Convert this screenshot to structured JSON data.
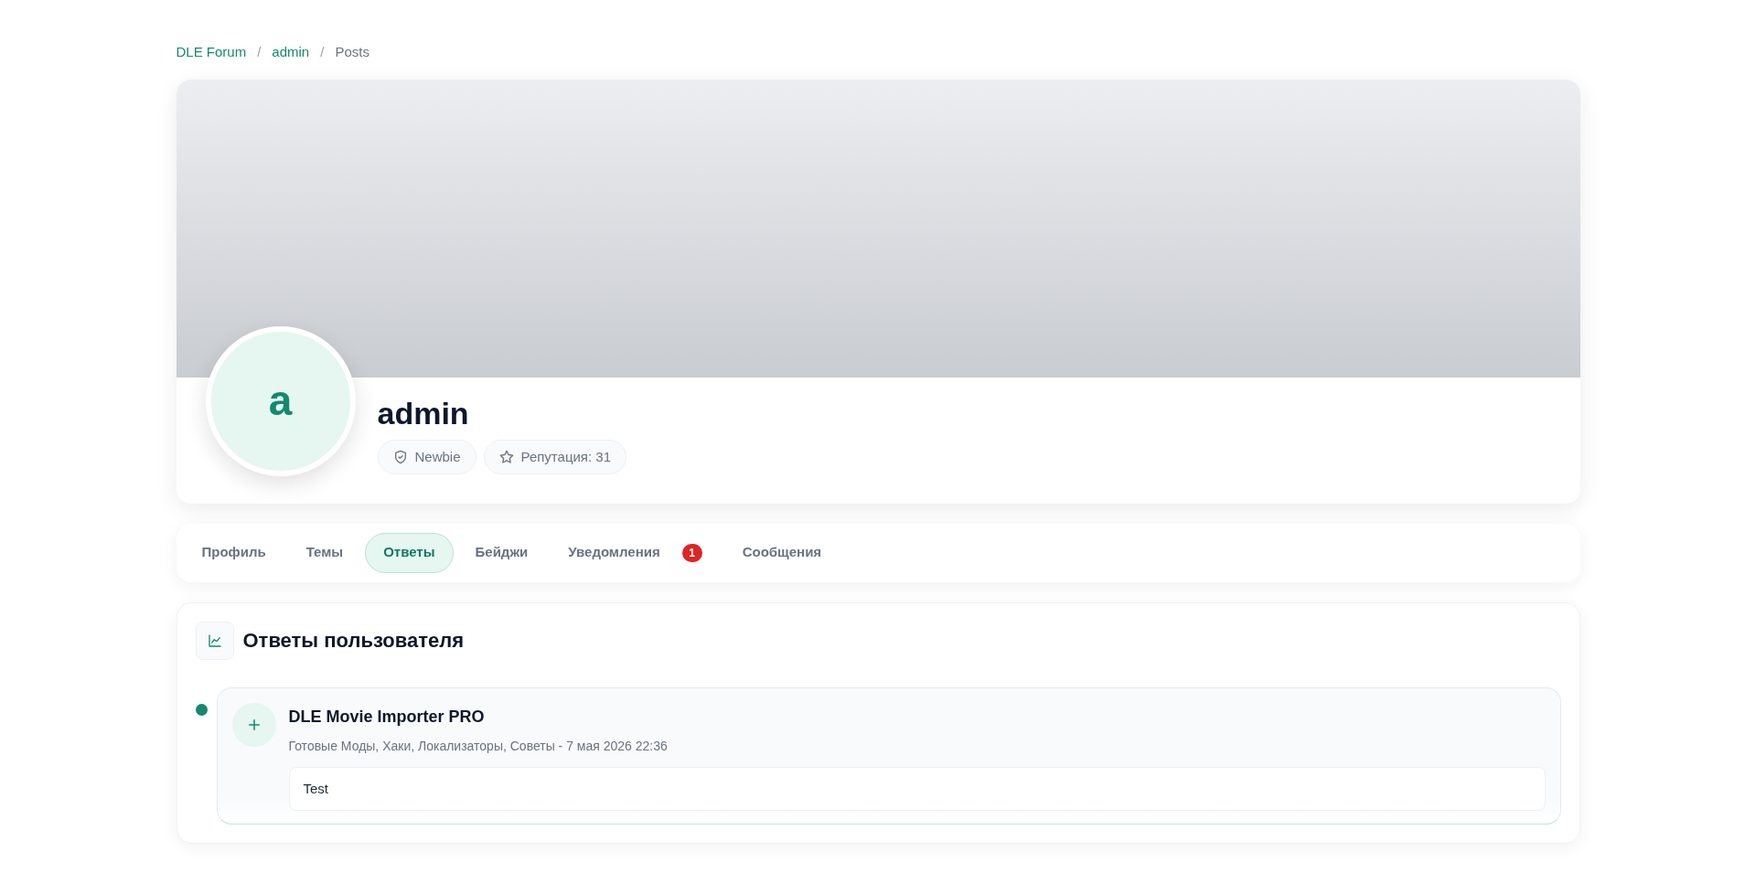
{
  "breadcrumb": [
    {
      "label": "DLE Forum",
      "kind": "link"
    },
    {
      "label": "/",
      "kind": "separator"
    },
    {
      "label": "admin",
      "kind": "link"
    },
    {
      "label": "/",
      "kind": "separator"
    },
    {
      "label": "Posts",
      "kind": "current"
    }
  ],
  "profile": {
    "avatar_letter": "a",
    "name": "admin",
    "badges": [
      {
        "kind": "rank",
        "label": "Newbie"
      },
      {
        "kind": "reputation",
        "label": "Репутация: 31"
      }
    ]
  },
  "tabs": [
    {
      "label": "Профиль",
      "selected": false
    },
    {
      "label": "Темы",
      "selected": false
    },
    {
      "label": "Ответы",
      "selected": true
    },
    {
      "label": "Бейджи",
      "selected": false
    },
    {
      "label": "Уведомления",
      "selected": false,
      "count": "1"
    },
    {
      "label": "Сообщения",
      "selected": false
    }
  ],
  "section": {
    "title": "Ответы пользователя",
    "posts": [
      {
        "title": "DLE Movie Importer PRO",
        "meta": "Готовые Моды, Хаки, Локализаторы, Советы - 7 мая 2026 22:36",
        "text": "Test"
      }
    ]
  }
}
